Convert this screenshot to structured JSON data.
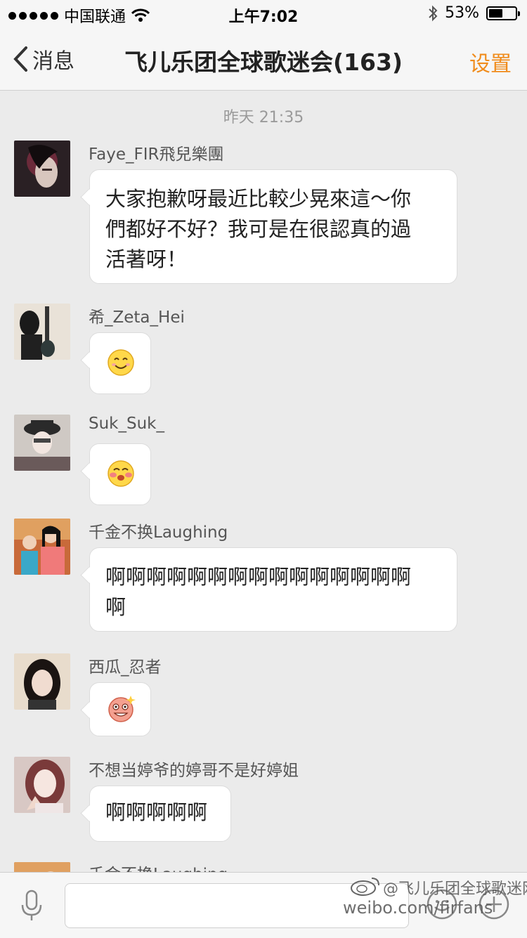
{
  "status_bar": {
    "carrier": "中国联通",
    "time": "上午7:02",
    "battery": "53%",
    "battery_level": 0.53,
    "icons": [
      "signal-dots-icon",
      "wifi-icon",
      "bluetooth-icon",
      "battery-icon"
    ]
  },
  "nav": {
    "back_label": "消息",
    "title": "飞儿乐团全球歌迷会(163)",
    "settings_label": "设置",
    "accent_color": "#f08c1c"
  },
  "chat": {
    "timestamp": "昨天 21:35",
    "messages": [
      {
        "sender": "Faye_FIR飛兒樂團",
        "text_lines": [
          "大家抱歉呀最近比較少晃來這～你",
          "們都好不好？我可是在很認真的過",
          "活著呀！"
        ]
      },
      {
        "sender": "希_Zeta_Hei",
        "emoji": "smile-emoji-icon"
      },
      {
        "sender": "Suk_Suk_",
        "emoji": "blush-emoji-icon"
      },
      {
        "sender": "千金不换Laughing",
        "text_lines": [
          "啊啊啊啊啊啊啊啊啊啊啊啊啊啊啊",
          "啊"
        ]
      },
      {
        "sender": "西瓜_忍者",
        "emoji": "pink-excited-emoji-icon"
      },
      {
        "sender": "不想当婷爷的婷哥不是好婷姐",
        "text_lines": [
          "啊啊啊啊啊"
        ]
      },
      {
        "sender": "千金不换Laughing"
      }
    ]
  },
  "input_bar": {
    "icons": [
      "microphone-icon",
      "emoji-face-icon",
      "plus-icon"
    ]
  },
  "watermark": {
    "line1": "@飞儿乐团全球歌迷网",
    "line2": "weibo.com/firfans"
  }
}
